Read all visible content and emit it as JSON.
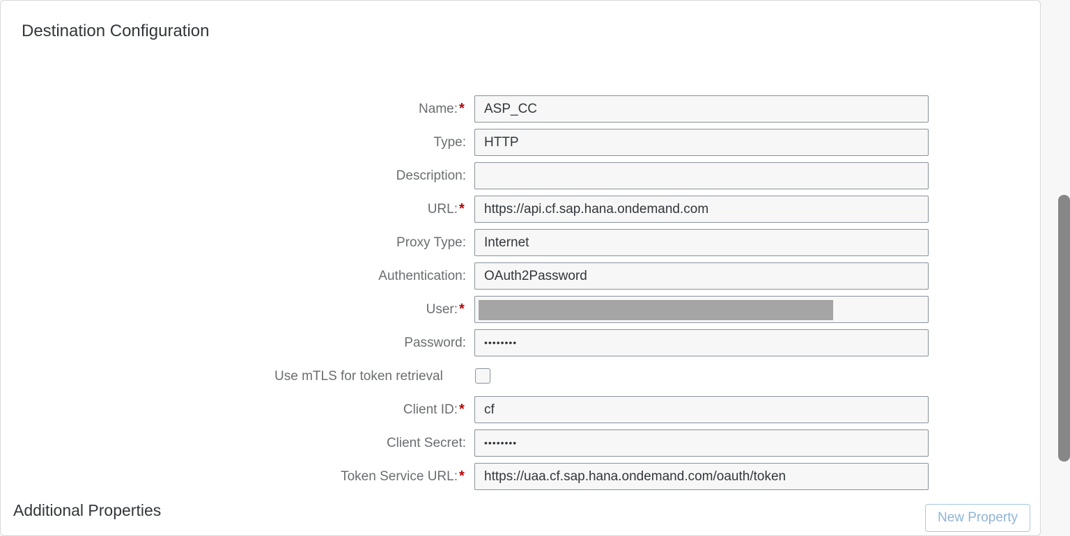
{
  "title": "Destination Configuration",
  "fields": {
    "name": {
      "label": "Name:",
      "value": "ASP_CC"
    },
    "type": {
      "label": "Type:",
      "value": "HTTP"
    },
    "description": {
      "label": "Description:",
      "value": ""
    },
    "url": {
      "label": "URL:",
      "value": "https://api.cf.sap.hana.ondemand.com"
    },
    "proxy_type": {
      "label": "Proxy Type:",
      "value": "Internet"
    },
    "authentication": {
      "label": "Authentication:",
      "value": "OAuth2Password"
    },
    "user": {
      "label": "User:",
      "value": ""
    },
    "password": {
      "label": "Password:",
      "value": "••••••••"
    },
    "mtls": {
      "label": "Use mTLS for token retrieval",
      "checked": false
    },
    "client_id": {
      "label": "Client ID:",
      "value": "cf"
    },
    "client_secret": {
      "label": "Client Secret:",
      "value": "••••••••"
    },
    "token_service_url": {
      "label": "Token Service URL:",
      "value": "https://uaa.cf.sap.hana.ondemand.com/oauth/token"
    }
  },
  "required_marker": "*",
  "additional_properties": {
    "heading": "Additional Properties",
    "new_property_label": "New Property"
  },
  "colors": {
    "required": "#bb0000",
    "label": "#6a6d70",
    "field_border": "#89919a",
    "button_text_disabled": "#8eb4d8"
  }
}
